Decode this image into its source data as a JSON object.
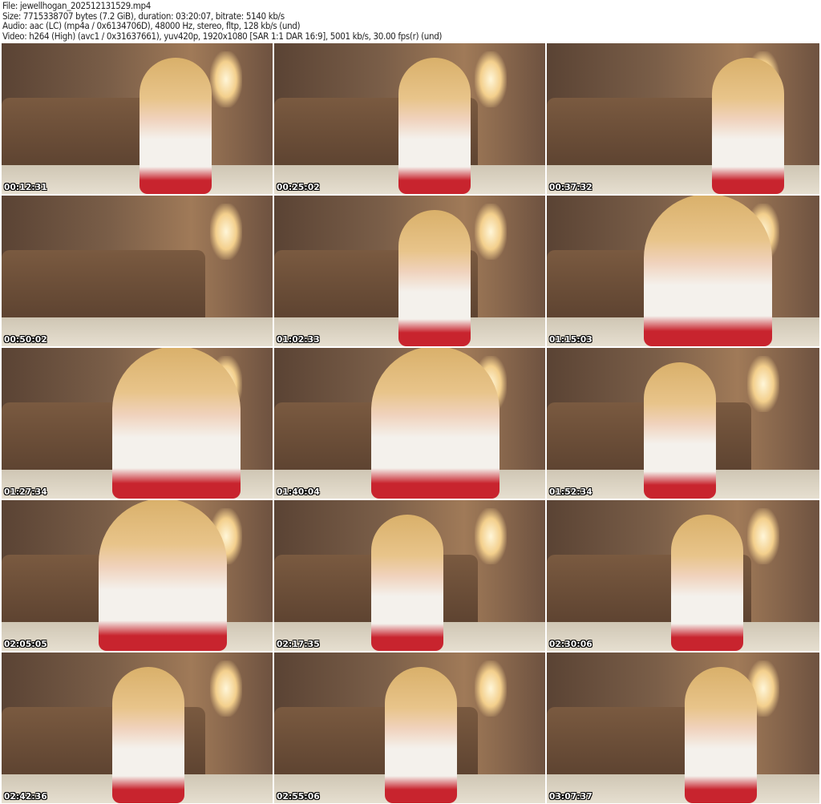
{
  "header": {
    "file": "File: jewellhogan_202512131529.mp4",
    "size": "Size: 7715338707 bytes (7.2 GiB), duration: 03:20:07, bitrate: 5140 kb/s",
    "audio": "Audio: aac (LC) (mp4a / 0x6134706D), 48000 Hz, stereo, fltp, 128 kb/s (und)",
    "video": "Video: h264 (High) (avc1 / 0x31637661), yuv420p, 1920x1080 [SAR 1:1 DAR 16:9], 5001 kb/s, 30.00 fps(r) (und)"
  },
  "thumbnails": [
    {
      "timestamp": "00:12:31"
    },
    {
      "timestamp": "00:25:02"
    },
    {
      "timestamp": "00:37:32"
    },
    {
      "timestamp": "00:50:02"
    },
    {
      "timestamp": "01:02:33"
    },
    {
      "timestamp": "01:15:03"
    },
    {
      "timestamp": "01:27:34"
    },
    {
      "timestamp": "01:40:04"
    },
    {
      "timestamp": "01:52:34"
    },
    {
      "timestamp": "02:05:05"
    },
    {
      "timestamp": "02:17:35"
    },
    {
      "timestamp": "02:30:06"
    },
    {
      "timestamp": "02:42:36"
    },
    {
      "timestamp": "02:55:06"
    },
    {
      "timestamp": "03:07:37"
    }
  ]
}
